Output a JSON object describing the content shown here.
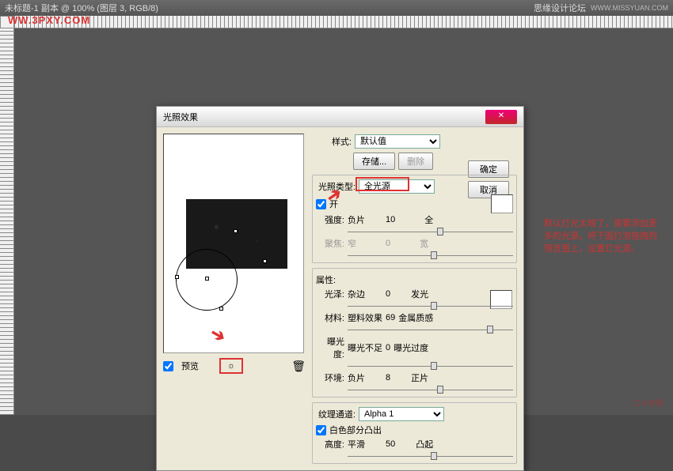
{
  "titlebar": {
    "doc": "未标题-1 副本 @ 100% (图层 3, RGB/8)",
    "forum": "思缘设计论坛",
    "site": "WWW.MISSYUAN.COM"
  },
  "watermark": "WW.3PXY.COM",
  "dialog": {
    "title": "光照效果",
    "close": "✕",
    "ok": "确定",
    "cancel": "取消",
    "style_label": "样式:",
    "style_value": "默认值",
    "save": "存储...",
    "delete": "删除",
    "light_type_label": "光照类型:",
    "light_type_value": "全光源",
    "on_label": "开",
    "intensity": {
      "label": "强度:",
      "left": "负片",
      "val": "10",
      "right": "全"
    },
    "focus": {
      "label": "聚焦:",
      "left": "窄",
      "val": "0",
      "right": "宽"
    },
    "props_label": "属性:",
    "gloss": {
      "label": "光泽:",
      "left": "杂边",
      "val": "0",
      "right": "发光"
    },
    "material": {
      "label": "材料:",
      "left": "塑料效果",
      "val": "69",
      "right": "金属质感"
    },
    "exposure": {
      "label": "曝光度:",
      "left": "曝光不足",
      "val": "0",
      "right": "曝光过度"
    },
    "ambience": {
      "label": "环境:",
      "left": "负片",
      "val": "8",
      "right": "正片"
    },
    "texture_label": "纹理通道:",
    "texture_value": "Alpha 1",
    "white_high": "白色部分凸出",
    "height": {
      "label": "高度:",
      "left": "平滑",
      "val": "50",
      "right": "凸起"
    },
    "preview": "预览",
    "bulb": "☼",
    "trash": "🗑"
  },
  "side_note": "默认灯光太暗了，需要添加更多的光源。将下面灯泡拖拽到预览图上，设置灯光源。",
  "side_wm": "三✕学院"
}
